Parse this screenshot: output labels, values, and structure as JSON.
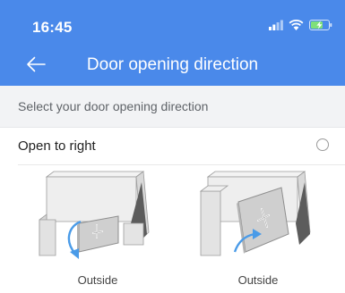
{
  "status_bar": {
    "time": "16:45",
    "icons": [
      "signal-icon",
      "wifi-icon",
      "battery-charging-icon"
    ]
  },
  "nav": {
    "title": "Door opening direction",
    "back_icon": "back-arrow-icon"
  },
  "instruction": "Select your door opening direction",
  "option": {
    "label": "Open to right",
    "selected": false
  },
  "illustrations": [
    {
      "caption": "Outside"
    },
    {
      "caption": "Outside"
    }
  ],
  "colors": {
    "header": "#4a89ea",
    "subheader_bg": "#f2f3f5",
    "arrow": "#4a9be8"
  }
}
